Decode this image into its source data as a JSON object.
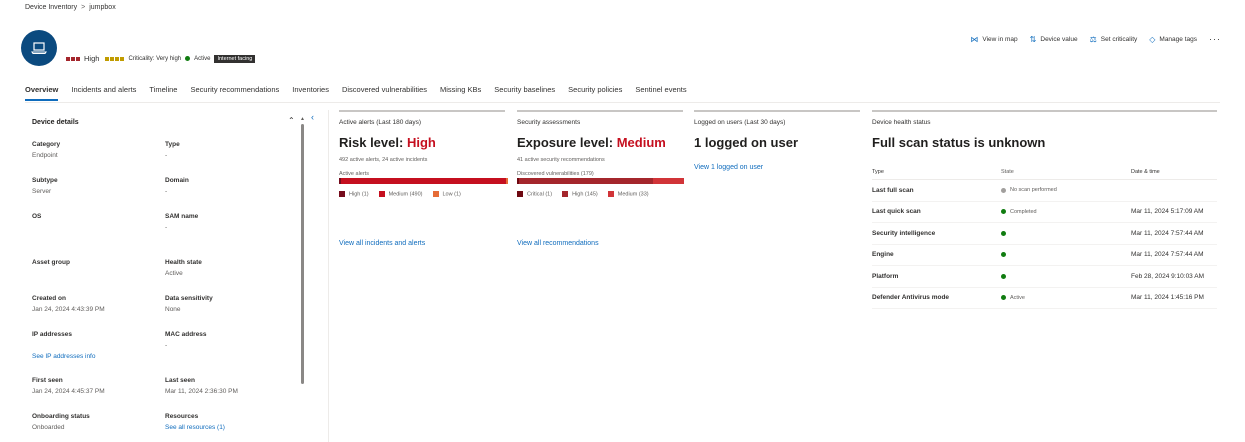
{
  "breadcrumb": {
    "root": "Device Inventory",
    "separator": ">",
    "current": "jumpbox"
  },
  "header": {
    "risk_label": "High",
    "criticality_text": "Criticality: Very high",
    "status_text": "Active",
    "tag": "Internet facing",
    "colors": {
      "risk": "#a4262c",
      "criticality": "#c19c00",
      "active": "#107c10",
      "avatar": "#0b4a7f"
    }
  },
  "actions": [
    {
      "icon": "map-icon",
      "label": "View in map"
    },
    {
      "icon": "sort-icon",
      "label": "Device value"
    },
    {
      "icon": "criticality-icon",
      "label": "Set criticality"
    },
    {
      "icon": "tag-icon",
      "label": "Manage tags"
    }
  ],
  "tabs": [
    "Overview",
    "Incidents and alerts",
    "Timeline",
    "Security recommendations",
    "Inventories",
    "Discovered vulnerabilities",
    "Missing KBs",
    "Security baselines",
    "Security policies",
    "Sentinel events"
  ],
  "device_details": {
    "heading": "Device details",
    "category": {
      "label": "Category",
      "value": "Endpoint"
    },
    "type": {
      "label": "Type",
      "value": "-"
    },
    "subtype": {
      "label": "Subtype",
      "value": "Server"
    },
    "domain": {
      "label": "Domain",
      "value": "-"
    },
    "os": {
      "label": "OS",
      "value": ""
    },
    "sam_name": {
      "label": "SAM name",
      "value": "-"
    },
    "asset_group": {
      "label": "Asset group",
      "value": ""
    },
    "health_state": {
      "label": "Health state",
      "value": "Active"
    },
    "created_on": {
      "label": "Created on",
      "value": "Jan 24, 2024 4:43:39 PM"
    },
    "data_sensitivity": {
      "label": "Data sensitivity",
      "value": "None"
    },
    "ip_addresses": {
      "label": "IP addresses",
      "link": "See IP addresses info"
    },
    "mac_address": {
      "label": "MAC address",
      "value": "-"
    },
    "first_seen": {
      "label": "First seen",
      "value": "Jan 24, 2024 4:45:37 PM"
    },
    "last_seen": {
      "label": "Last seen",
      "value": "Mar 11, 2024 2:36:30 PM"
    },
    "onboarding_status": {
      "label": "Onboarding status",
      "value": "Onboarded"
    },
    "resources": {
      "label": "Resources",
      "link": "See all resources (1)"
    }
  },
  "alerts_card": {
    "label": "Active alerts (Last 180 days)",
    "title_prefix": "Risk level: ",
    "title_value": "High",
    "sub": "492 active alerts, 24 active incidents",
    "bar_label": "Active alerts",
    "legend": [
      {
        "label": "High (1)",
        "color": "#750b1c",
        "value": 1
      },
      {
        "label": "Medium (490)",
        "color": "#c50f1f",
        "value": 490
      },
      {
        "label": "Low (1)",
        "color": "#e66c37",
        "value": 1
      }
    ],
    "link": "View all incidents and alerts"
  },
  "assessments_card": {
    "label": "Security assessments",
    "title_prefix": "Exposure level: ",
    "title_value": "Medium",
    "sub": "41 active security recommendations",
    "bar_label": "Discovered vulnerabilities (179)",
    "legend": [
      {
        "label": "Critical (1)",
        "color": "#6e0811",
        "value": 1
      },
      {
        "label": "High (145)",
        "color": "#a4262c",
        "value": 145
      },
      {
        "label": "Medium (33)",
        "color": "#d13438",
        "value": 33
      }
    ],
    "link": "View all recommendations"
  },
  "users_card": {
    "label": "Logged on users (Last 30 days)",
    "title": "1 logged on user",
    "link": "View 1 logged on user"
  },
  "health": {
    "label": "Device health status",
    "title": "Full scan status is unknown",
    "columns": [
      "Type",
      "State",
      "Date & time"
    ],
    "rows": [
      {
        "type": "Last full scan",
        "state": "No scan performed",
        "dot": "#a19f9d",
        "date": ""
      },
      {
        "type": "Last quick scan",
        "state": "Completed",
        "dot": "#107c10",
        "date": "Mar 11, 2024 5:17:09 AM"
      },
      {
        "type": "Security intelligence",
        "state": "",
        "dot": "#107c10",
        "date": "Mar 11, 2024 7:57:44 AM"
      },
      {
        "type": "Engine",
        "state": "",
        "dot": "#107c10",
        "date": "Mar 11, 2024 7:57:44 AM"
      },
      {
        "type": "Platform",
        "state": "",
        "dot": "#107c10",
        "date": "Feb 28, 2024 9:10:03 AM"
      },
      {
        "type": "Defender Antivirus mode",
        "state": "Active",
        "dot": "#107c10",
        "date": "Mar 11, 2024 1:45:16 PM"
      }
    ]
  }
}
